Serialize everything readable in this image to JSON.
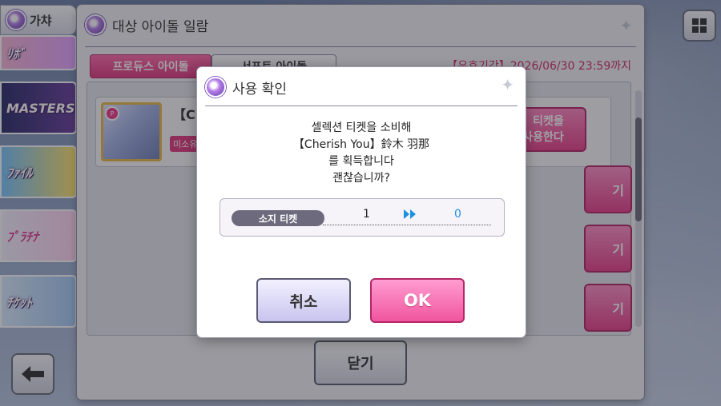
{
  "top_tab": {
    "label": "가챠"
  },
  "side_banners": [
    "ﾘﾎﾞ",
    "MASTERS",
    "ﾌｧｲﾙ",
    "ﾌﾟﾗﾁﾅ",
    "ﾁｹｯﾄ"
  ],
  "list_panel": {
    "title": "대상 아이돌 일람",
    "tabs": {
      "produce": "프로듀스 아이돌",
      "support": "서포트 아이돌"
    },
    "deadline": "【유효기간】2026/06/30 23:59까지",
    "idol_row": {
      "name_fragment": "【C",
      "unowned_badge": "미소유",
      "use_button": [
        "티켓을",
        "사용한다"
      ]
    },
    "side_button_label": "기",
    "close_button": "닫기"
  },
  "modal": {
    "title": "사용 확인",
    "message_lines": [
      "셀렉션 티켓을 소비해",
      "【Cherish You】鈴木 羽那",
      "를 획득합니다",
      "괜찮습니까?"
    ],
    "ticket": {
      "label": "소지 티켓",
      "before": "1",
      "after": "0"
    },
    "cancel": "취소",
    "ok": "OK"
  },
  "colors": {
    "accent_pink": "#e8418b",
    "ticket_after_blue": "#1f8fe0",
    "deadline_red": "#d02a6a"
  },
  "icons": [
    "gacha-orb-icon",
    "sparkle-icon",
    "double-arrow-icon",
    "back-arrow-icon",
    "grid-icon"
  ]
}
